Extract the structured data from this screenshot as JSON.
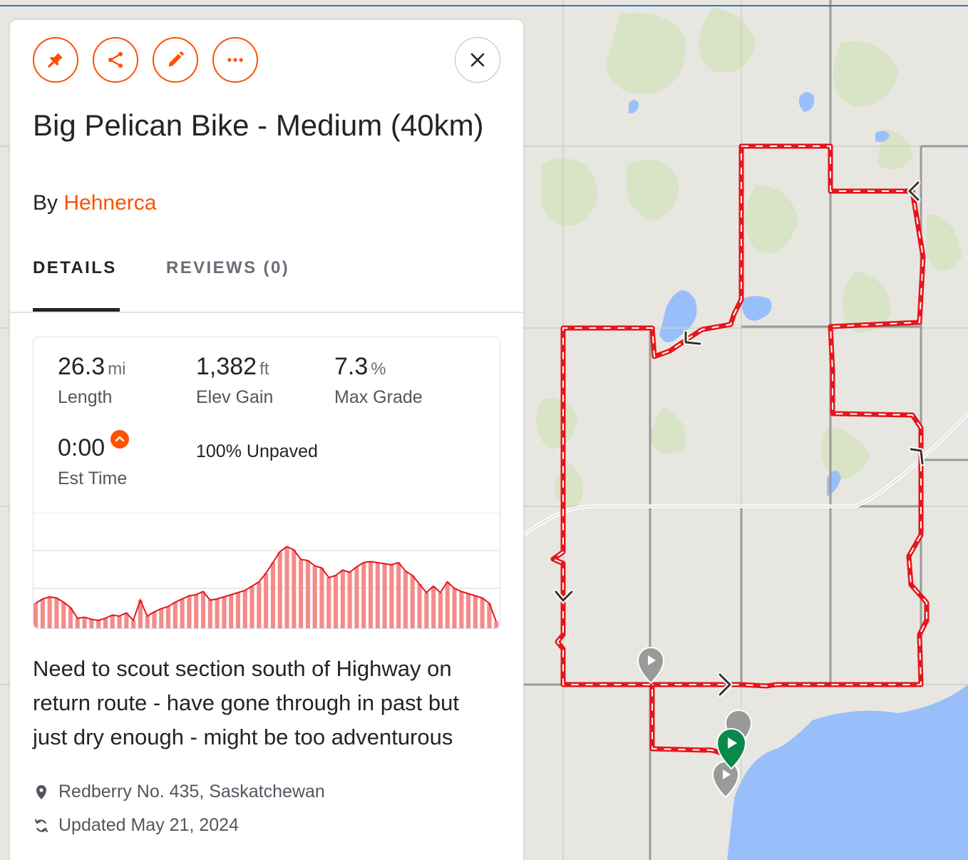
{
  "colors": {
    "brand": "#fc5200",
    "route_red": "#e5161b",
    "water": "#99bffb",
    "map_bg": "#e8e6e1",
    "woods": "#d9e3c5",
    "elevation_fill": "#f58a8a"
  },
  "actions": [
    {
      "icon": "pin-icon"
    },
    {
      "icon": "share-icon"
    },
    {
      "icon": "pencil-icon"
    },
    {
      "icon": "more-icon"
    }
  ],
  "close_icon": "close-icon",
  "route": {
    "title": "Big Pelican Bike - Medium (40km)",
    "by_prefix": "By",
    "author": "Hehnerca"
  },
  "tabs": [
    {
      "label": "DETAILS",
      "active": true
    },
    {
      "label": "REVIEWS (0)",
      "active": false
    }
  ],
  "stats": {
    "length": {
      "value": "26.3",
      "unit": "mi",
      "label": "Length"
    },
    "elev_gain": {
      "value": "1,382",
      "unit": "ft",
      "label": "Elev Gain"
    },
    "max_grade": {
      "value": "7.3",
      "unit": "%",
      "label": "Max Grade"
    },
    "est_time": {
      "value": "0:00",
      "label": "Est Time"
    },
    "surface": "100% Unpaved"
  },
  "chart_data": {
    "type": "area",
    "title": "",
    "xlabel": "",
    "ylabel": "",
    "profile_fraction": [
      0.22,
      0.26,
      0.28,
      0.27,
      0.23,
      0.18,
      0.08,
      0.09,
      0.07,
      0.06,
      0.08,
      0.11,
      0.1,
      0.13,
      0.06,
      0.25,
      0.1,
      0.14,
      0.17,
      0.19,
      0.23,
      0.26,
      0.29,
      0.3,
      0.33,
      0.25,
      0.26,
      0.28,
      0.3,
      0.32,
      0.34,
      0.38,
      0.42,
      0.5,
      0.6,
      0.7,
      0.75,
      0.72,
      0.63,
      0.62,
      0.57,
      0.55,
      0.46,
      0.48,
      0.53,
      0.51,
      0.56,
      0.6,
      0.61,
      0.6,
      0.59,
      0.58,
      0.6,
      0.52,
      0.48,
      0.4,
      0.32,
      0.38,
      0.32,
      0.42,
      0.36,
      0.33,
      0.31,
      0.29,
      0.27,
      0.22,
      0.05
    ]
  },
  "description": "Need to scout section south of Highway on return route - have gone through in past but just dry enough - might be too adventurous",
  "location": {
    "icon": "location-pin-icon",
    "text": "Redberry No. 435, Saskatchewan"
  },
  "updated": {
    "icon": "sync-icon",
    "text": "Updated May 21, 2024"
  }
}
